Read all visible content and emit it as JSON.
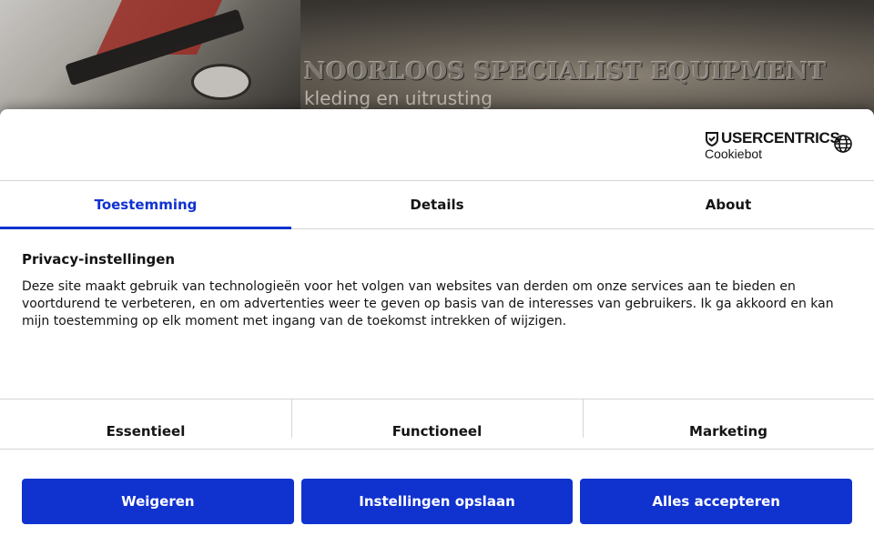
{
  "banner": {
    "title": "NOORLOOS SPECIALIST EQUIPMENT",
    "subtitle": "kleding en uitrusting"
  },
  "brand": {
    "name": "USERCENTRICS",
    "product": "Cookiebot"
  },
  "tabs": [
    {
      "label": "Toestemming",
      "active": true
    },
    {
      "label": "Details",
      "active": false
    },
    {
      "label": "About",
      "active": false
    }
  ],
  "content": {
    "heading": "Privacy-instellingen",
    "body": "Deze site maakt gebruik van technologieën voor het volgen van websites van derden om onze services aan te bieden en voortdurend te verbeteren, en om advertenties weer te geven op basis van de interesses van gebruikers. Ik ga akkoord en kan mijn toestemming op elk moment met ingang van de toekomst intrekken of wijzigen."
  },
  "categories": [
    {
      "label": "Essentieel"
    },
    {
      "label": "Functioneel"
    },
    {
      "label": "Marketing"
    }
  ],
  "buttons": {
    "deny": "Weigeren",
    "save": "Instellingen opslaan",
    "accept_all": "Alles accepteren"
  },
  "colors": {
    "accent": "#1032cf",
    "text": "#141414",
    "divider": "#d6d6d6"
  },
  "icons": {
    "brand": "shield-check-icon",
    "language": "globe-icon"
  }
}
